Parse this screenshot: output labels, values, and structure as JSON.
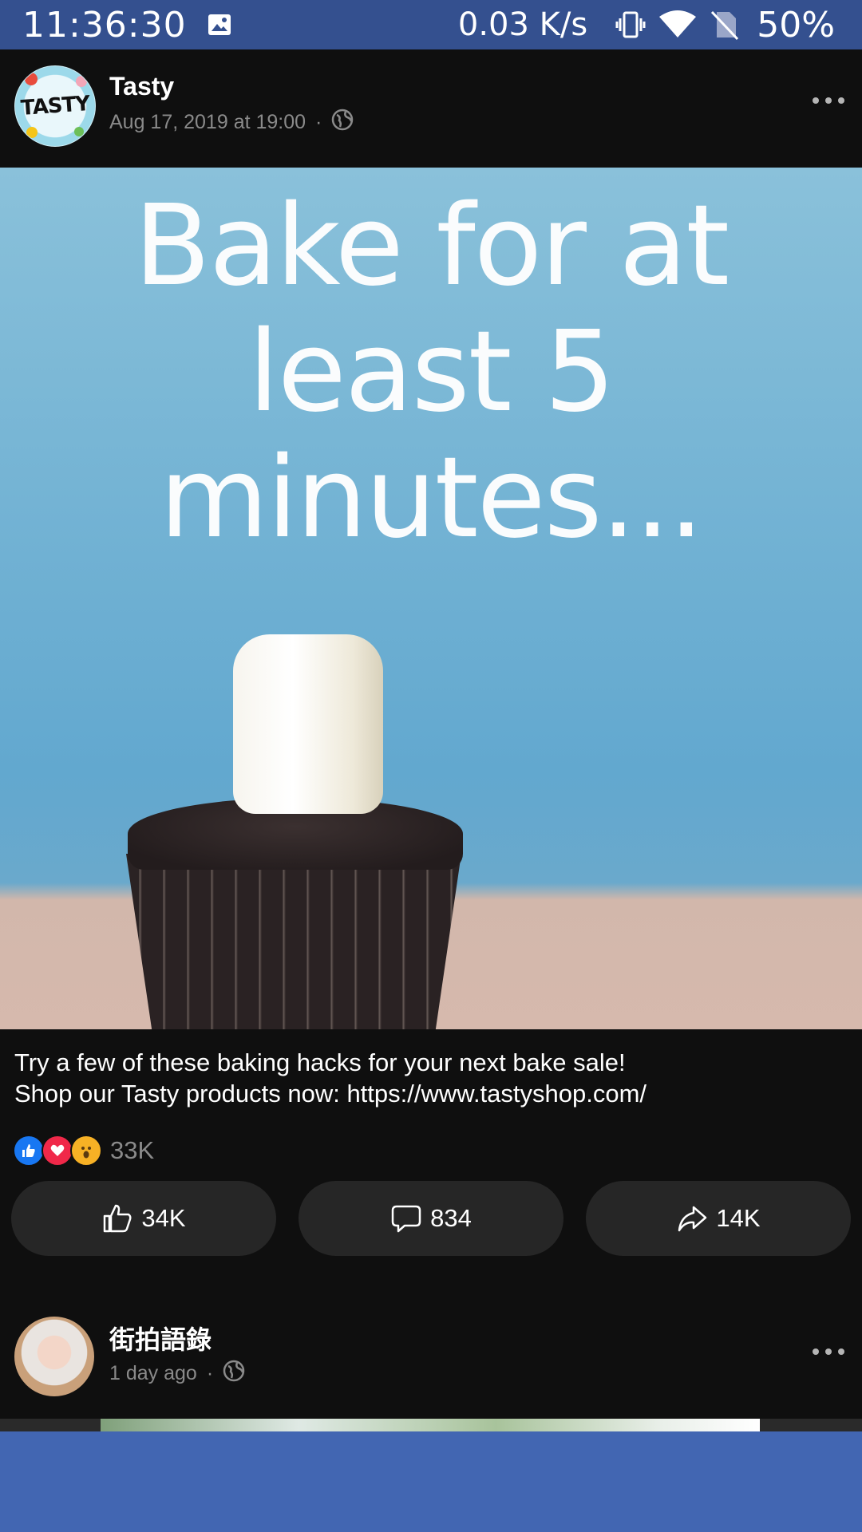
{
  "status_bar": {
    "time": "11:36:30",
    "network_speed": "0.03 K/s",
    "battery": "50%",
    "icons": [
      "gallery-icon",
      "vibrate-icon",
      "wifi-icon",
      "no-sim-icon"
    ]
  },
  "posts": [
    {
      "author": "Tasty",
      "avatar_text": "TASTY",
      "timestamp": "Aug 17, 2019 at 19:00",
      "separator": "·",
      "privacy_icon": "globe-icon",
      "media_caption_lines": [
        "Bake for at",
        "least 5",
        "minutes..."
      ],
      "text_lines": [
        "Try a few of these baking hacks for your next bake sale!",
        "Shop our Tasty products now: https://www.tastyshop.com/"
      ],
      "reactions": {
        "icons": [
          "like-reaction-icon",
          "love-reaction-icon",
          "wow-reaction-icon"
        ],
        "count": "33K"
      },
      "actions": {
        "like_count": "34K",
        "comment_count": "834",
        "share_count": "14K"
      }
    },
    {
      "author": "街拍語錄",
      "timestamp": "1 day ago",
      "separator": "·",
      "privacy_icon": "globe-icon"
    }
  ],
  "colors": {
    "status_bar": "#34508f",
    "background": "#0f0f0f",
    "button": "#262626",
    "bottom_band": "#4266b2",
    "meta_text": "#8a8a8a"
  }
}
